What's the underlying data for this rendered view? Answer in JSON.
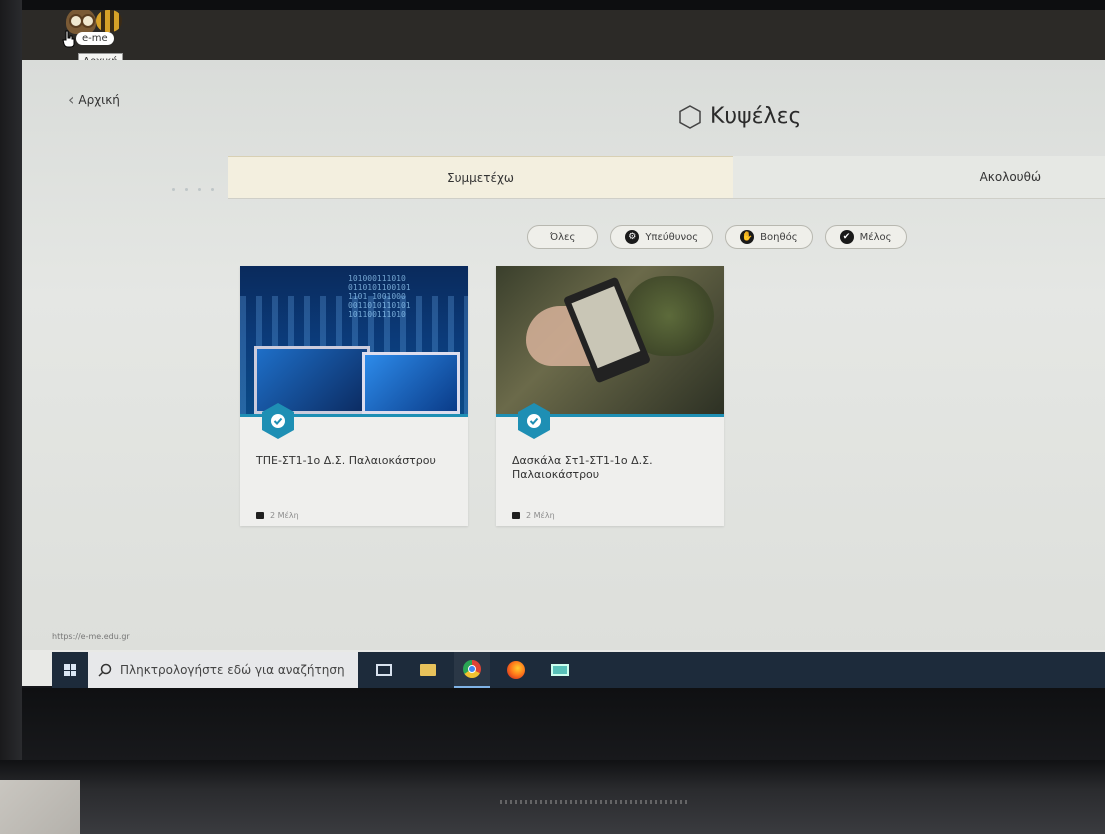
{
  "app": {
    "logo_text": "e-me",
    "tooltip": "Αρχική",
    "status_url": "https://e-me.edu.gr"
  },
  "header": {
    "back_label": "Αρχική",
    "title": "Κυψέλες"
  },
  "tabs": [
    {
      "label": "Συμμετέχω",
      "active": true
    },
    {
      "label": "Ακολουθώ",
      "active": false
    }
  ],
  "filters": [
    {
      "label": "Όλες",
      "icon": ""
    },
    {
      "label": "Υπεύθυνος",
      "icon": "gear-icon"
    },
    {
      "label": "Βοηθός",
      "icon": "hand-icon"
    },
    {
      "label": "Μέλος",
      "icon": "check-icon"
    }
  ],
  "cards": [
    {
      "title": "ΤΠΕ-ΣΤ1-1ο Δ.Σ. Παλαιοκάστρου",
      "members": "2 Μέλη",
      "image": "technology-image"
    },
    {
      "title": "Δασκάλα Στ1-ΣΤ1-1ο Δ.Σ. Παλαιοκάστρου",
      "members": "2 Μέλη",
      "image": "ebook-reader-image"
    }
  ],
  "taskbar": {
    "search_placeholder": "Πληκτρολογήστε εδώ για αναζήτηση",
    "icons": [
      "windows-icon",
      "task-view-icon",
      "file-explorer-icon",
      "chrome-icon",
      "firefox-icon",
      "remote-desktop-icon"
    ]
  },
  "colors": {
    "accent": "#1e8fb4",
    "active_tab": "#f3efdf",
    "taskbar": "#1d2b3b"
  }
}
